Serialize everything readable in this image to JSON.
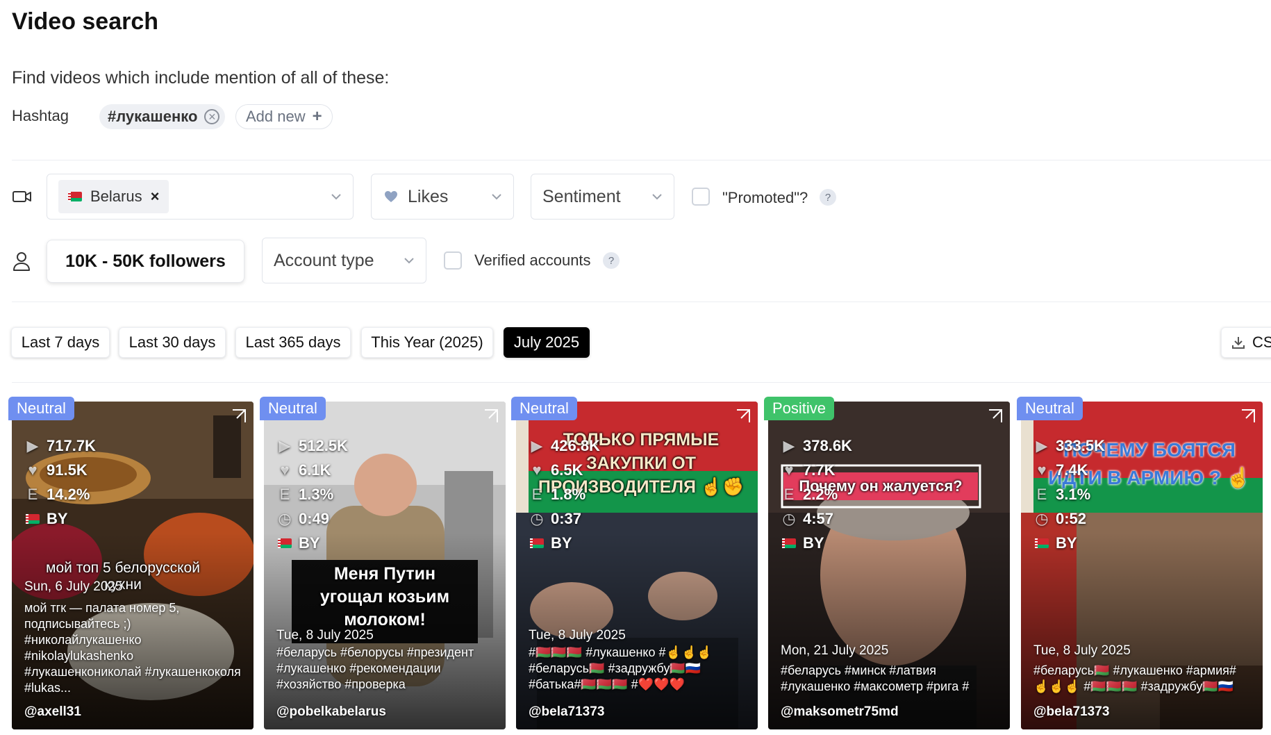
{
  "page": {
    "title": "Video search",
    "intro": "Find videos which include mention of all of these:"
  },
  "hashtag_filter": {
    "label": "Hashtag",
    "tags": [
      "#лукашенко"
    ],
    "add_label": "Add new"
  },
  "filters": {
    "country": {
      "value": "Belarus"
    },
    "likes": {
      "label": "Likes"
    },
    "sentiment": {
      "label": "Sentiment"
    },
    "promoted": {
      "label": "\"Promoted\"?",
      "checked": false
    },
    "followers": {
      "label": "10K - 50K followers"
    },
    "account_type": {
      "label": "Account type"
    },
    "verified": {
      "label": "Verified accounts",
      "checked": false
    }
  },
  "help_glyph": "?",
  "date_ranges": [
    "Last 7 days",
    "Last 30 days",
    "Last 365 days",
    "This Year (2025)",
    "July 2025"
  ],
  "date_selected": "July 2025",
  "export": {
    "label": "CS"
  },
  "colors": {
    "neutral": "#6f8ff0",
    "positive": "#3fc36a",
    "active": "#000000"
  },
  "videos": [
    {
      "sentiment": "Neutral",
      "plays": "717.7K",
      "likes": "91.5K",
      "engagement": "14.2%",
      "duration": "",
      "country": "BY",
      "caption_overlay": "мой топ 5 белорусской кухни",
      "date": "Sun, 6 July 2025",
      "description": "мой тгк — палата номер 5, подписывайтесь ;) #николайлукашенко #nikolaylukashenko #лукашенкониколай #лукашенкоколя #lukas...",
      "user": "@axell31"
    },
    {
      "sentiment": "Neutral",
      "plays": "512.5K",
      "likes": "6.1K",
      "engagement": "1.3%",
      "duration": "0:49",
      "country": "BY",
      "caption_overlay": "Меня Путин угощал козьим молоком!",
      "date": "Tue, 8 July 2025",
      "description": "#беларусь #белорусы #президент #лукашенко #рекомендации #хозяйство #проверка",
      "user": "@pobelkabelarus"
    },
    {
      "sentiment": "Neutral",
      "plays": "426.8K",
      "likes": "6.5K",
      "engagement": "1.8%",
      "duration": "0:37",
      "country": "BY",
      "caption_overlay": "ТОЛЬКО ПРЯМЫЕ ЗАКУПКИ ОТ ПРОИЗВОДИТЕЛЯ ☝️✊",
      "date": "Tue, 8 July 2025",
      "description": "#🇧🇾🇧🇾🇧🇾 #лукашенко #☝️☝️☝️ #беларусь🇧🇾 #задружбу🇧🇾🇷🇺 #батька#🇧🇾🇧🇾🇧🇾 #❤️❤️❤️",
      "user": "@bela71373"
    },
    {
      "sentiment": "Positive",
      "plays": "378.6K",
      "likes": "7.7K",
      "engagement": "2.2%",
      "duration": "4:57",
      "country": "BY",
      "caption_overlay": "Почему он жалуется?",
      "date": "Mon, 21 July 2025",
      "description": "#беларусь #минск #латвия #лукашенко #максометр #рига #",
      "user": "@maksometr75md"
    },
    {
      "sentiment": "Neutral",
      "plays": "333.5K",
      "likes": "7.4K",
      "engagement": "3.1%",
      "duration": "0:52",
      "country": "BY",
      "caption_overlay": "ПОЧЕМУ БОЯТСЯ ИДТИ В АРМИЮ ? ☝️",
      "date": "Tue, 8 July 2025",
      "description": "#беларусь🇧🇾 #лукашенко #армия# ☝️☝️☝️ #🇧🇾🇧🇾🇧🇾 #задружбу🇧🇾🇷🇺",
      "user": "@bela71373"
    }
  ]
}
